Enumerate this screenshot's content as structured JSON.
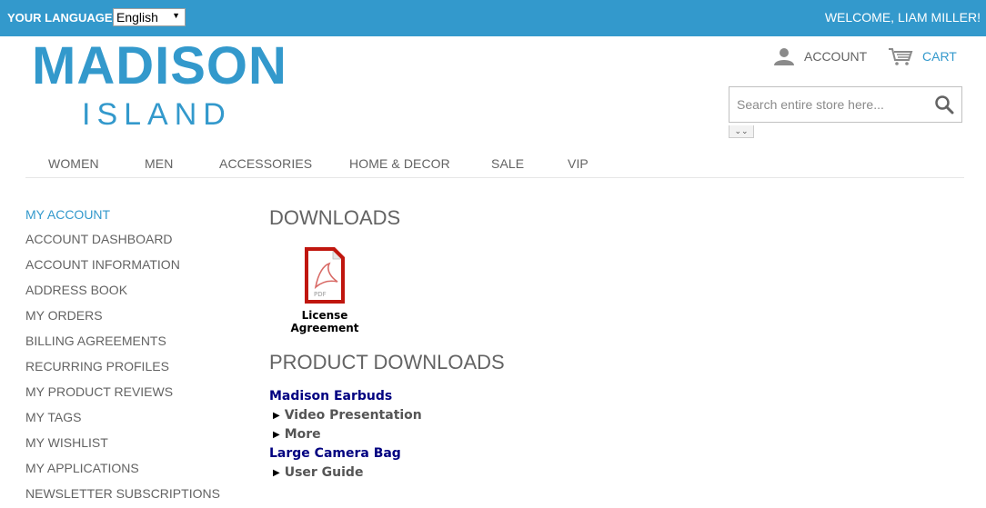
{
  "topbar": {
    "language_label": "YOUR LANGUAGE:",
    "language_value": "English",
    "welcome": "WELCOME, LIAM MILLER!"
  },
  "logo": {
    "main": "MADISON",
    "sub": "ISLAND"
  },
  "header": {
    "account": "ACCOUNT",
    "cart": "CART",
    "search_placeholder": "Search entire store here..."
  },
  "nav": [
    "WOMEN",
    "MEN",
    "ACCESSORIES",
    "HOME & DECOR",
    "SALE",
    "VIP"
  ],
  "sidebar": {
    "title": "MY ACCOUNT",
    "items": [
      "ACCOUNT DASHBOARD",
      "ACCOUNT INFORMATION",
      "ADDRESS BOOK",
      "MY ORDERS",
      "BILLING AGREEMENTS",
      "RECURRING PROFILES",
      "MY PRODUCT REVIEWS",
      "MY TAGS",
      "MY WISHLIST",
      "MY APPLICATIONS",
      "NEWSLETTER SUBSCRIPTIONS"
    ]
  },
  "main": {
    "title": "DOWNLOADS",
    "pdf": {
      "line1": "License",
      "line2": "Agreement",
      "icon_text": "PDF"
    },
    "section_title": "PRODUCT DOWNLOADS",
    "products": [
      {
        "name": "Madison Earbuds",
        "links": [
          "Video Presentation",
          "More"
        ]
      },
      {
        "name": "Large Camera Bag",
        "links": [
          "User Guide"
        ]
      }
    ]
  },
  "colors": {
    "brand": "#3399cc",
    "text": "#636363",
    "product_name": "#000080"
  }
}
